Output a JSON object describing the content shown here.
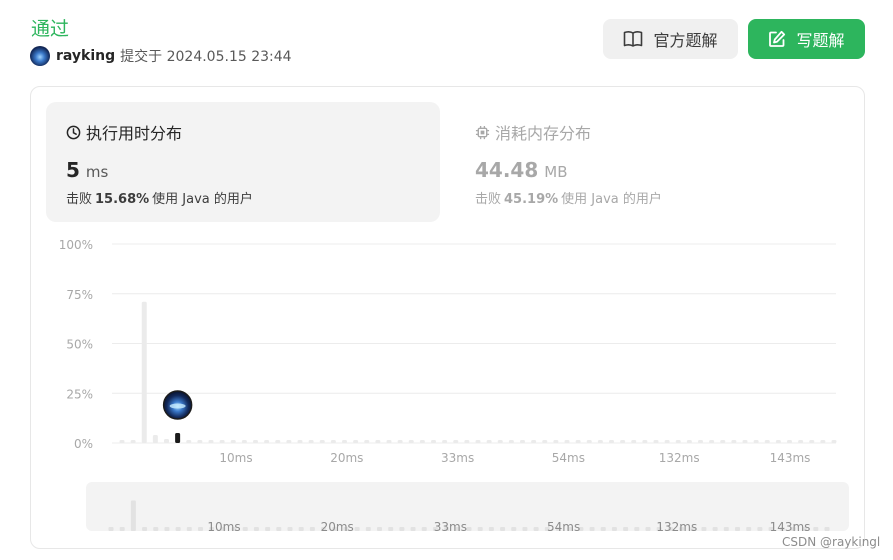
{
  "header": {
    "status": "通过",
    "username": "rayking",
    "submitted_text": "提交于 2024.05.15 23:44"
  },
  "buttons": {
    "official_solution": "官方题解",
    "write_solution": "写题解"
  },
  "runtime": {
    "title": "执行用时分布",
    "value": "5",
    "unit": "ms",
    "beat_prefix": "击败",
    "beat_percent": "15.68%",
    "beat_suffix": "使用 Java 的用户"
  },
  "memory": {
    "title": "消耗内存分布",
    "value": "44.48",
    "unit": "MB",
    "beat_prefix": "击败",
    "beat_percent": "45.19%",
    "beat_suffix": "使用 Java 的用户"
  },
  "chart_data": {
    "type": "bar",
    "y_ticks": [
      "100%",
      "75%",
      "50%",
      "25%",
      "0%"
    ],
    "ylim": [
      0,
      100
    ],
    "x_tick_labels": [
      "10ms",
      "20ms",
      "33ms",
      "54ms",
      "132ms",
      "143ms"
    ],
    "bar_count": 65,
    "highlight_index": 5,
    "highlight_label": "5 ms",
    "values": [
      1.5,
      1.5,
      71,
      4,
      2,
      5,
      1.5,
      1.5,
      1.5,
      1.5,
      1.5,
      1.5,
      1.5,
      1.5,
      1.5,
      1.5,
      1.5,
      1.5,
      1.5,
      1.5,
      1.5,
      1.5,
      1.5,
      1.5,
      1.5,
      1.5,
      1.5,
      1.5,
      1.5,
      1.5,
      1.5,
      1.5,
      1.5,
      1.5,
      1.5,
      1.5,
      1.5,
      1.5,
      1.5,
      1.5,
      1.5,
      1.5,
      1.5,
      1.5,
      1.5,
      1.5,
      1.5,
      1.5,
      1.5,
      1.5,
      1.5,
      1.5,
      1.5,
      1.5,
      1.5,
      1.5,
      1.5,
      1.5,
      1.5,
      1.5,
      1.5,
      1.5,
      1.5,
      1.5,
      1.5
    ],
    "overview_x_tick_labels": [
      "10ms",
      "20ms",
      "33ms",
      "54ms",
      "132ms",
      "143ms"
    ],
    "colors": {
      "bar": "#ebebeb",
      "highlight": "#1a1a1a",
      "grid": "#ececec",
      "overview_bg": "#f3f3f3",
      "overview_bar": "#e2e2e2"
    }
  },
  "footer": {
    "watermark": "CSDN @raykingl"
  }
}
